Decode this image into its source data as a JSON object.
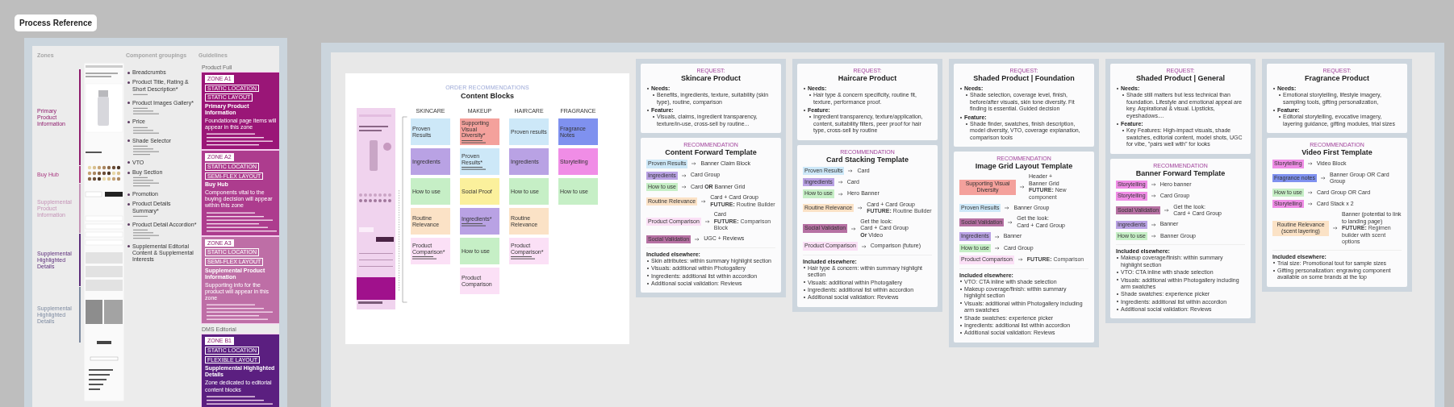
{
  "title": "Process Reference",
  "left": {
    "zones_heading": "Zones",
    "groupings_heading": "Component groupings",
    "guidelines_heading": "Guidelines",
    "zones": [
      {
        "label": "Primary Product Information",
        "color": "#8e1b6c"
      },
      {
        "label": "Buy Hub",
        "color": "#a8367f"
      },
      {
        "label": "Supplemental Product Information",
        "color": "#c493b6"
      },
      {
        "label": "Supplemental Highlighted Details",
        "color": "#5c2d7a"
      },
      {
        "label": "Supplemental Highlighted Details",
        "color": "#7d8aa0"
      }
    ],
    "groupings": [
      "Breadcrumbs",
      "Product Title, Rating & Short Description*",
      "Product Images Gallery*",
      "Price",
      "Shade Selector",
      "VTO",
      "Buy Section",
      "Promotion",
      "Product Details Summary*",
      "Product Detail Accordion*",
      "Supplemental Editorial Content & Supplemental Interests"
    ],
    "guidelines": [
      {
        "label": "Product Full",
        "boxes": [
          {
            "tags": [
              "ZONE A1",
              "STATIC LOCATION",
              "STATIC LAYOUT"
            ],
            "title": "Primary Product Information",
            "subtitle": "Foundational page items will appear in this zone",
            "color": "#9a1677"
          },
          {
            "tags": [
              "ZONE A2",
              "STATIC LOCATION",
              "SEMI-FLEX LAYOUT"
            ],
            "title": "Buy Hub",
            "subtitle": "Components vital to the buying decision will appear within this zone",
            "color": "#ad3c8e"
          },
          {
            "tags": [
              "ZONE A3",
              "STATIC LOCATION",
              "SEMI-FLEX LAYOUT"
            ],
            "title": "Supplemental Product Information",
            "subtitle": "Supporting info for the product will appear in this zone",
            "color": "#be6ea6"
          }
        ]
      },
      {
        "label": "DMS Editorial",
        "boxes": [
          {
            "tags": [
              "ZONE B1",
              "STATIC LOCATION",
              "FLEXIBLE LAYOUT"
            ],
            "title": "Supplemental Highlighted Details",
            "subtitle": "Zone dedicated to editorial content blocks",
            "color": "#5b1f80"
          }
        ]
      }
    ]
  },
  "content_blocks": {
    "label": "ORDER RECOMMENDATIONS",
    "title": "Content Blocks",
    "columns": [
      {
        "header": "SKINCARE",
        "blocks": [
          {
            "label": "Proven Results",
            "color": "#cde8f8",
            "note": false
          },
          {
            "label": "Ingredients",
            "color": "#b9a2e4",
            "note": false
          },
          {
            "label": "How to use",
            "color": "#c6efc6",
            "note": false
          },
          {
            "label": "Routine Relevance",
            "color": "#fbe2c6",
            "note": false
          },
          {
            "label": "Product Comparison*",
            "color": "#fbe0f6",
            "note": true
          }
        ]
      },
      {
        "header": "MAKEUP",
        "blocks": [
          {
            "label": "Supporting Visual Diversity*",
            "color": "#f4a19c",
            "note": true
          },
          {
            "label": "Proven Results*",
            "color": "#cde8f8",
            "note": true
          },
          {
            "label": "Social Proof",
            "color": "#fbf09c",
            "note": false
          },
          {
            "label": "Ingredients*",
            "color": "#b9a2e4",
            "note": true
          },
          {
            "label": "How to use",
            "color": "#c6efc6",
            "note": false
          },
          {
            "label": "Product Comparison",
            "color": "#fbe0f6",
            "note": false
          }
        ]
      },
      {
        "header": "HAIRCARE",
        "blocks": [
          {
            "label": "Proven results",
            "color": "#cde8f8",
            "note": false
          },
          {
            "label": "Ingredients",
            "color": "#b9a2e4",
            "note": false
          },
          {
            "label": "How to use",
            "color": "#c6efc6",
            "note": false
          },
          {
            "label": "Routine Relevance",
            "color": "#fbe2c6",
            "note": false
          },
          {
            "label": "Product Comparison*",
            "color": "#fbe0f6",
            "note": true
          }
        ]
      },
      {
        "header": "FRAGRANCE",
        "blocks": [
          {
            "label": "Fragrance Notes",
            "color": "#7f91ef",
            "note": false
          },
          {
            "label": "Storytelling",
            "color": "#f08de6",
            "note": false
          },
          {
            "label": "How to use",
            "color": "#c6efc6",
            "note": false
          }
        ]
      }
    ]
  },
  "columns": [
    {
      "request": {
        "label": "REQUEST:",
        "title": "Skincare Product",
        "needs_label": "Needs:",
        "needs": [
          "Benefits, ingredients, texture, suitability (skin type), routine, comparison"
        ],
        "feature_label": "Feature:",
        "features": [
          "Visuals, claims, ingredient transparency, texture/in-use, cross-sell by routine..."
        ]
      },
      "recommendation": {
        "label": "RECOMMENDATION",
        "title": "Content Forward Template",
        "rows": [
          {
            "tag": "Proven Results",
            "color": "#cde8f8",
            "targets": [
              "Banner Claim Block"
            ]
          },
          {
            "tag": "Ingredients",
            "color": "#b9a2e4",
            "targets": [
              "Card Group"
            ]
          },
          {
            "tag": "How to use",
            "color": "#c6efc6",
            "targets": [
              "Card **OR** Banner Grid"
            ]
          },
          {
            "tag": "Routine Relevance",
            "color": "#fbe2c6",
            "targets": [
              "Card + Card Group"
            ],
            "future": "**FUTURE:** Routine Builder"
          },
          {
            "tag": "Product Comparison",
            "color": "#fbe0f6",
            "targets": [
              "Card"
            ],
            "future": "**FUTURE:** Comparison Block"
          },
          {
            "tag": "Social Validation",
            "color": "#b671a3",
            "targets": [
              "UGC + Reviews"
            ]
          }
        ],
        "elsewhere_title": "Included elsewhere:",
        "elsewhere": [
          "Skin attributes: within summary highlight section",
          "Visuals: additional within Photogallery",
          "Ingredients: additional list within accordion",
          "Additional social validation: Reviews"
        ]
      }
    },
    {
      "request": {
        "label": "REQUEST:",
        "title": "Haircare Product",
        "needs_label": "Needs:",
        "needs": [
          "Hair type & concern specificity, routine fit, texture, performance proof."
        ],
        "feature_label": "Feature:",
        "features": [
          "Ingredient transparency, texture/application, content, suitability filters, peer proof for hair type, cross-sell by routine"
        ]
      },
      "recommendation": {
        "label": "RECOMMENDATION",
        "title": "Card Stacking Template",
        "rows": [
          {
            "tag": "Proven Results",
            "color": "#cde8f8",
            "targets": [
              "Card"
            ]
          },
          {
            "tag": "Ingredients",
            "color": "#b9a2e4",
            "targets": [
              "Card"
            ]
          },
          {
            "tag": "How to use",
            "color": "#c6efc6",
            "targets": [
              "Hero Banner"
            ]
          },
          {
            "tag": "Routine Relevance",
            "color": "#fbe2c6",
            "targets": [
              "Card + Card Group"
            ],
            "future": "**FUTURE:** Routine Builder"
          },
          {
            "tag": "Social Validation",
            "color": "#b671a3",
            "targets": [
              "Get the look:",
              "Card + Card Group",
              "**Or** Video"
            ]
          },
          {
            "tag": "Product Comparison",
            "color": "#fbe0f6",
            "targets": [
              "Comparison (future)"
            ]
          }
        ],
        "elsewhere_title": "Included elsewhere:",
        "elsewhere": [
          "Hair type & concern: within summary highlight section",
          "Visuals: additional within Photogallery",
          "Ingredients: additional list within accordion",
          "Additional social validation: Reviews"
        ]
      }
    },
    {
      "request": {
        "label": "REQUEST:",
        "title": "Shaded Product | Foundation",
        "needs_label": "Needs:",
        "needs": [
          "Shade selection, coverage level, finish, before/after visuals, skin tone diversity. Fit finding is essential. Guided decision"
        ],
        "feature_label": "Feature:",
        "features": [
          "Shade finder, swatches, finish description, model diversity, VTO, coverage explanation, comparison tools"
        ]
      },
      "recommendation": {
        "label": "RECOMMENDATION",
        "title": "Image Grid Layout Template",
        "rows": [
          {
            "tag": "Supporting Visual Diversity",
            "color": "#f4a19c",
            "targets": [
              "Header +",
              "Banner Grid"
            ],
            "future": "**FUTURE:** New component"
          },
          {
            "tag": "Proven Results",
            "color": "#cde8f8",
            "targets": [
              "Banner Group"
            ]
          },
          {
            "tag": "Social Validation",
            "color": "#b671a3",
            "targets": [
              "Get the look:",
              "Card + Card Group"
            ]
          },
          {
            "tag": "Ingredients",
            "color": "#b9a2e4",
            "targets": [
              "Banner"
            ]
          },
          {
            "tag": "How to use",
            "color": "#c6efc6",
            "targets": [
              "Card Group"
            ]
          },
          {
            "tag": "Product Comparison",
            "color": "#fbe0f6",
            "future": "**FUTURE:** Comparison"
          }
        ],
        "elsewhere_title": "Included elsewhere:",
        "elsewhere": [
          "VTO: CTA inline with shade selection",
          "Makeup coverage/finish: within summary highlight section",
          "Visuals: additional within Photogallery including arm swatches",
          "Shade swatches: experience picker",
          "Ingredients: additional list within accordion",
          "Additional social validation: Reviews"
        ]
      }
    },
    {
      "request": {
        "label": "REQUEST:",
        "title": "Shaded Product | General",
        "needs_label": "Needs:",
        "needs": [
          "Shade still matters but less technical than foundation. Lifestyle and emotional appeal are key. Aspirational & visual. Lipsticks, eyeshadows...."
        ],
        "feature_label": "Feature:",
        "features": [
          "Key Features:  High-impact visuals, shade swatches, editorial content, model shots, UGC for vibe, \"pairs well with\" for looks"
        ]
      },
      "recommendation": {
        "label": "RECOMMENDATION",
        "title": "Banner Forward Template",
        "rows": [
          {
            "tag": "Storytelling",
            "color": "#f08de6",
            "targets": [
              "Hero banner"
            ]
          },
          {
            "tag": "Storytelling",
            "color": "#f08de6",
            "targets": [
              "Card Group"
            ]
          },
          {
            "tag": "Social Validation",
            "color": "#b671a3",
            "targets": [
              "Get the look:",
              "Card + Card Group"
            ]
          },
          {
            "tag": "Ingredients",
            "color": "#b9a2e4",
            "targets": [
              "Banner"
            ]
          },
          {
            "tag": "How to use",
            "color": "#c6efc6",
            "targets": [
              "Banner Group"
            ]
          }
        ],
        "elsewhere_title": "Included elsewhere:",
        "elsewhere": [
          "Makeup coverage/finish: within summary highlight section",
          "VTO: CTA inline with shade selection",
          "Visuals: additional within Photogallery including arm swatches",
          "Shade swatches: experience picker",
          "Ingredients: additional list within accordion",
          "Additional social validation: Reviews"
        ]
      }
    },
    {
      "request": {
        "label": "REQUEST:",
        "title": "Fragrance Product",
        "needs_label": "Needs:",
        "needs": [
          "Emotional storytelling, lifestyle imagery, sampling tools, gifting personalization,"
        ],
        "feature_label": "Feature:",
        "features": [
          "Editorial storytelling, evocative imagery, layering guidance, gifting modules, trial sizes"
        ]
      },
      "recommendation": {
        "label": "RECOMMENDATION",
        "title": "Video First Template",
        "rows": [
          {
            "tag": "Storytelling",
            "color": "#f08de6",
            "targets": [
              "Video Block"
            ]
          },
          {
            "tag": "Fragrance notes",
            "color": "#7f91ef",
            "targets": [
              "Banner Group OR Card Group"
            ]
          },
          {
            "tag": "How to use",
            "color": "#c6efc6",
            "targets": [
              "Card Group OR Card"
            ]
          },
          {
            "tag": "Storytelling",
            "color": "#f08de6",
            "targets": [
              "Card Stack x 2"
            ]
          },
          {
            "tag": "Routine Relevance (scent layering)",
            "color": "#fbe2c6",
            "targets": [
              "Banner (potential to link to landing page)"
            ],
            "future": "**FUTURE:** Regimen builder with scent options"
          }
        ],
        "elsewhere_title": "Included elsewhere:",
        "elsewhere": [
          "Trial size: Promotional tout for sample sizes",
          "Gifting personalization: engraving component available on some brands at the top"
        ]
      }
    }
  ]
}
